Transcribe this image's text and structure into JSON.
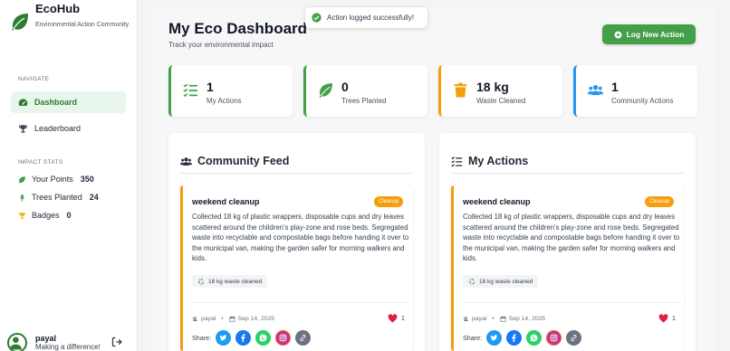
{
  "app": {
    "name": "EcoHub",
    "tagline": "Environmental Action Community"
  },
  "sidebar": {
    "navigate_label": "NAVIGATE",
    "nav": [
      {
        "label": "Dashboard",
        "icon": "gauge-icon",
        "active": true
      },
      {
        "label": "Leaderboard",
        "icon": "trophy-icon",
        "active": false
      }
    ],
    "stats_label": "IMPACT STATS",
    "stats": [
      {
        "label": "Your Points",
        "value": "350",
        "icon": "leaf-icon"
      },
      {
        "label": "Trees Planted",
        "value": "24",
        "icon": "tree-icon"
      },
      {
        "label": "Badges",
        "value": "0",
        "icon": "trophy-icon"
      }
    ],
    "user": {
      "name": "payal",
      "message": "Making a difference!"
    }
  },
  "header": {
    "title": "My Eco Dashboard",
    "subtitle": "Track your environmental impact",
    "log_button": "Log New Action"
  },
  "toast": {
    "message": "Action logged successfully!"
  },
  "stat_cards": [
    {
      "value": "1",
      "label": "My Actions",
      "icon": "tasks-icon",
      "color": "#43a047"
    },
    {
      "value": "0",
      "label": "Trees Planted",
      "icon": "leaf-icon",
      "color": "#43a047"
    },
    {
      "value": "18 kg",
      "label": "Waste Cleaned",
      "icon": "trash-icon",
      "color": "#f59e0b"
    },
    {
      "value": "1",
      "label": "Community Actions",
      "icon": "users-icon",
      "color": "#2196f3"
    }
  ],
  "panels": [
    {
      "title": "Community Feed",
      "icon": "users-icon",
      "post": {
        "title": "weekend cleanup",
        "badge": "Cleanup",
        "text": "Collected 18 kg of plastic wrappers, disposable cups and dry leaves scattered around the children's play-zone and rose beds. Segregated waste into recyclable and compostable bags before handing it over to the municipal van, making the garden safer for morning walkers and kids.",
        "impact": "18 kg waste cleaned",
        "author": "payal",
        "date": "Sep 14, 2025",
        "likes": "1",
        "share_label": "Share:"
      }
    },
    {
      "title": "My Actions",
      "icon": "tasks-icon",
      "post": {
        "title": "weekend cleanup",
        "badge": "Cleanup",
        "text": "Collected 18 kg of plastic wrappers, disposable cups and dry leaves scattered around the children's play-zone and rose beds. Segregated waste into recyclable and compostable bags before handing it over to the municipal van, making the garden safer for morning walkers and kids.",
        "impact": "18 kg waste cleaned",
        "author": "payal",
        "date": "Sep 14, 2025",
        "likes": "1",
        "share_label": "Share:"
      }
    }
  ],
  "colors": {
    "brand_green": "#43a047",
    "accent_orange": "#f59e0b",
    "accent_blue": "#2196f3",
    "like_red": "#e11d48"
  }
}
